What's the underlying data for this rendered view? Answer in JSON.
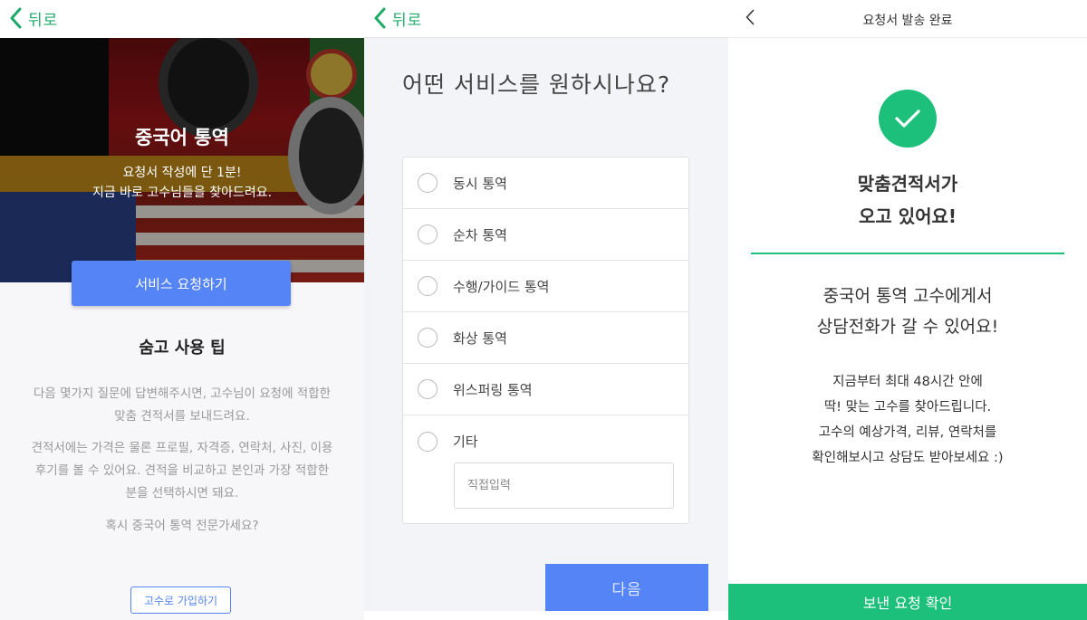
{
  "screen1": {
    "back_label": "뒤로",
    "hero_title": "중국어 통역",
    "hero_sub_line1": "요청서 작성에 단 1분!",
    "hero_sub_line2": "지금 바로 고수님들을 찾아드려요.",
    "request_button": "서비스 요청하기",
    "tips_title": "숨고 사용 팁",
    "tips_p1_line1": "다음 몇가지 질문에 답변해주시면, 고수님이 요청에 적합한",
    "tips_p1_line2": "맞춤 견적서를 보내드려요.",
    "tips_p2_line1": "견적서에는 가격은 물론 프로필, 자격증, 연락처, 사진, 이용",
    "tips_p2_line2": "후기를 볼 수 있어요. 견적을 비교하고 본인과 가장 적합한",
    "tips_p2_line3": "분을 선택하시면 돼요.",
    "tips_p3": "혹시 중국어 통역 전문가세요?",
    "join_button": "고수로 가입하기"
  },
  "screen2": {
    "back_label": "뒤로",
    "question": "어떤 서비스를 원하시나요?",
    "options": [
      {
        "label": "동시 통역"
      },
      {
        "label": "순차 통역"
      },
      {
        "label": "수행/가이드 통역"
      },
      {
        "label": "화상 통역"
      },
      {
        "label": "위스퍼링 통역"
      },
      {
        "label": "기타"
      }
    ],
    "direct_input_placeholder": "직접입력",
    "next_button": "다음"
  },
  "screen3": {
    "title": "요청서 발송 완료",
    "head_line1": "맞춤견적서가",
    "head_line2": "오고 있어요!",
    "mid_line1": "중국어 통역 고수에게서",
    "mid_line2": "상담전화가 갈 수 있어요!",
    "body_line1": "지금부터 최대 48시간 안에",
    "body_line2": "딱! 맞는 고수를 찾아드립니다.",
    "body_line3": "고수의 예상가격, 리뷰, 연락처를",
    "body_line4": "확인해보시고 상담도 받아보세요 :)",
    "confirm_button": "보낸 요청 확인"
  },
  "colors": {
    "accent_green": "#1cc07a",
    "back_green": "#1faa6a",
    "primary_blue": "#5484f5"
  }
}
